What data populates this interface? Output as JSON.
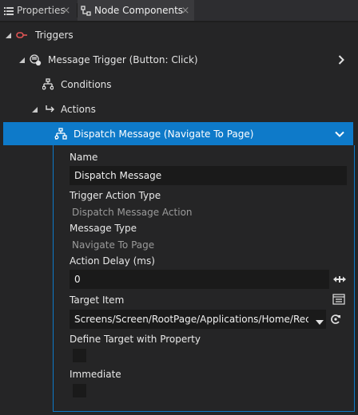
{
  "tabs": {
    "properties": {
      "label": "Properties",
      "icon": "list-icon"
    },
    "node_components": {
      "label": "Node Components",
      "icon": "node-components-icon"
    }
  },
  "tree": {
    "triggers": {
      "label": "Triggers",
      "icon": "trigger-icon"
    },
    "message_trigger": {
      "label": "Message Trigger (Button: Click)",
      "icon": "message-trigger-icon"
    },
    "conditions": {
      "label": "Conditions",
      "icon": "conditions-icon"
    },
    "actions": {
      "label": "Actions",
      "icon": "actions-icon"
    },
    "dispatch_message": {
      "label": "Dispatch Message (Navigate To Page)",
      "icon": "dispatch-message-icon"
    }
  },
  "form": {
    "name": {
      "label": "Name",
      "value": "Dispatch Message"
    },
    "trigger_action_type": {
      "label": "Trigger Action Type",
      "value": "Dispatch Message Action"
    },
    "message_type": {
      "label": "Message Type",
      "value": "Navigate To Page"
    },
    "action_delay": {
      "label": "Action Delay (ms)",
      "value": "0"
    },
    "target_item": {
      "label": "Target Item",
      "value": "Screens/Screen/RootPage/Applications/Home/Recent"
    },
    "define_target": {
      "label": "Define Target with Property",
      "checked": false
    },
    "immediate": {
      "label": "Immediate",
      "checked": false
    }
  },
  "colors": {
    "accent": "#0e7ac9",
    "background": "#252526",
    "trigger_icon": "#e05555"
  }
}
